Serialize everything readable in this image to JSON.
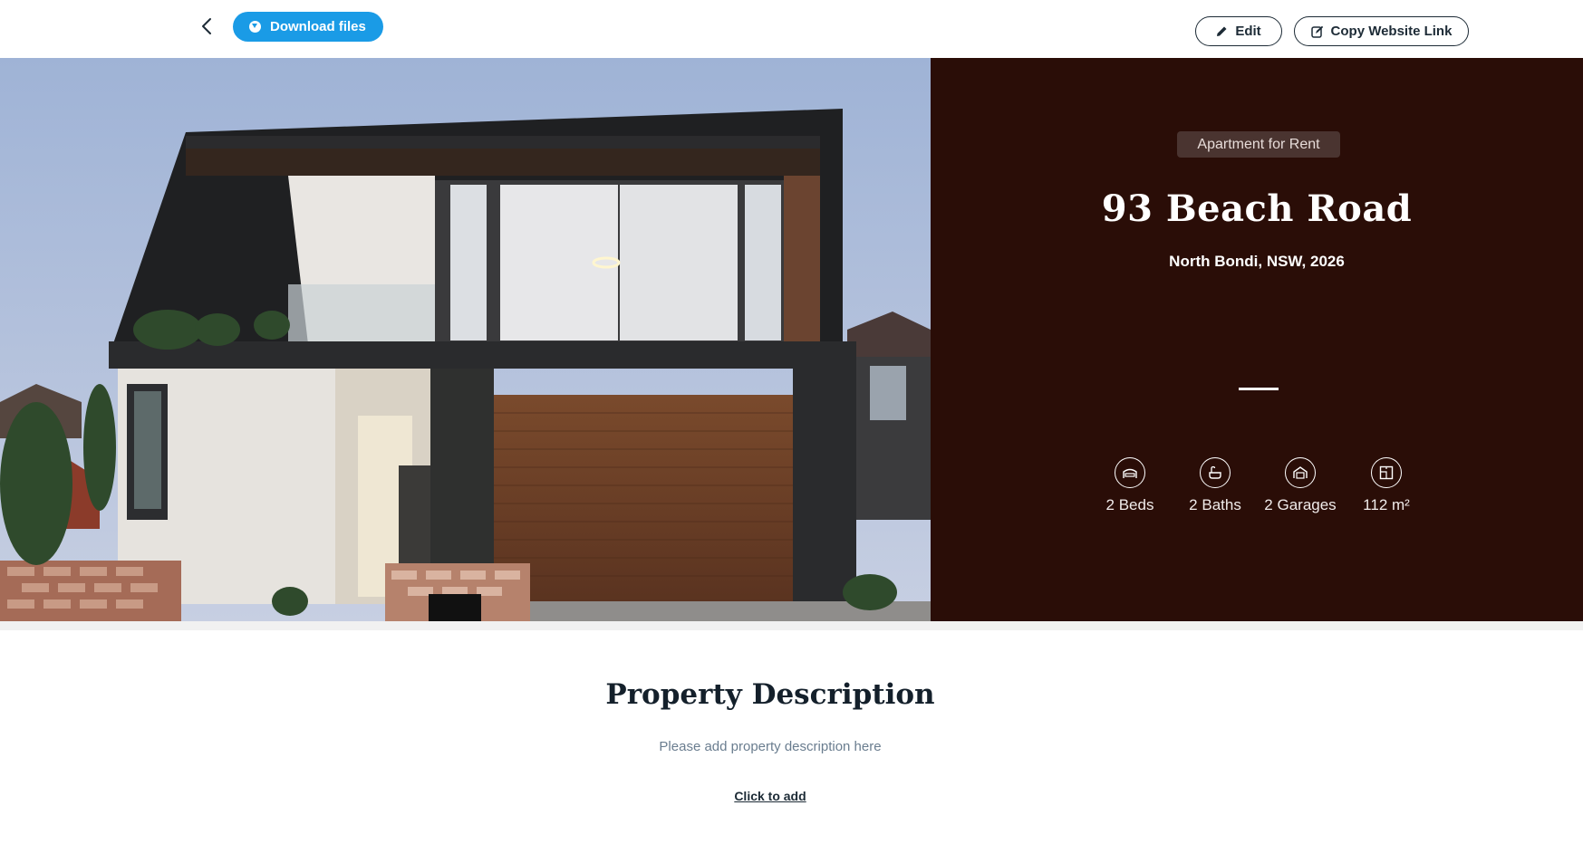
{
  "toolbar": {
    "download_label": "Download files",
    "edit_label": "Edit",
    "copy_link_label": "Copy Website Link"
  },
  "listing": {
    "badge": "Apartment for Rent",
    "address": "93 Beach Road",
    "suburb": "North Bondi, NSW, 2026",
    "features": [
      {
        "icon": "bed-icon",
        "label": "2 Beds"
      },
      {
        "icon": "bath-icon",
        "label": "2 Baths"
      },
      {
        "icon": "garage-icon",
        "label": "2 Garages"
      },
      {
        "icon": "floorplan-icon",
        "label": "112 m²"
      }
    ]
  },
  "description": {
    "title": "Property Description",
    "placeholder": "Please add property description here",
    "add_link": "Click to add"
  },
  "colors": {
    "accent": "#1a9be6",
    "panel": "#2a0d07",
    "text_dark": "#14202b"
  }
}
